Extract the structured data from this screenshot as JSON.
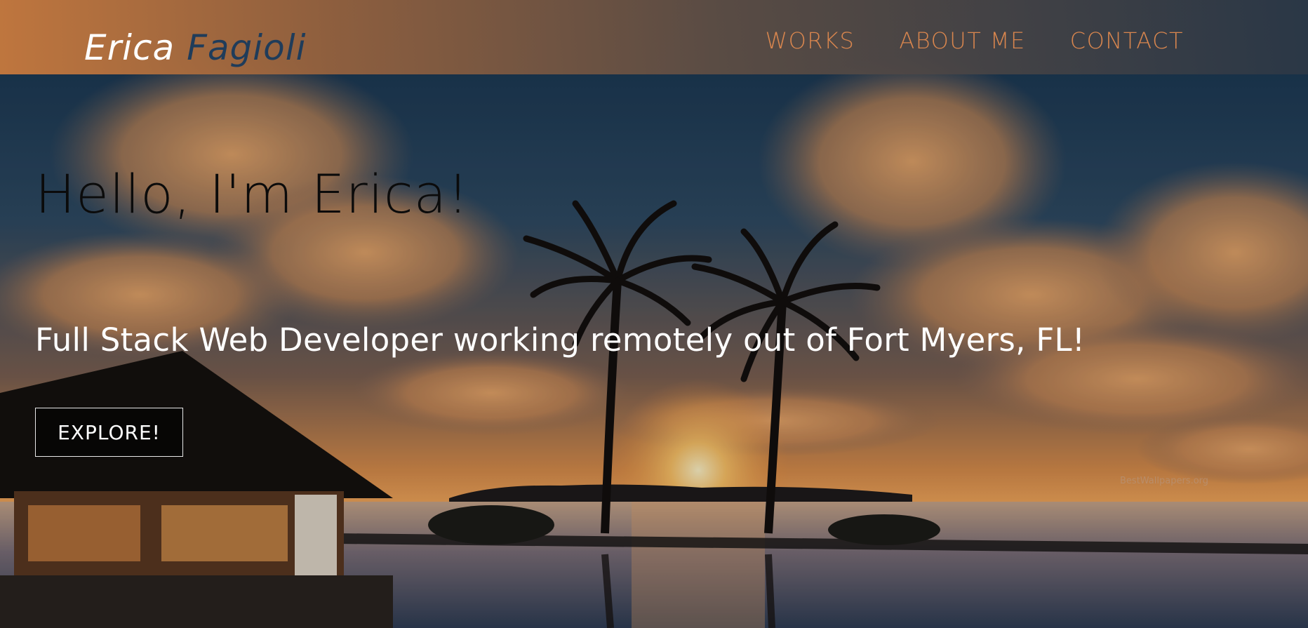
{
  "brand": {
    "first_name": "Erica",
    "last_name": "Fagioli"
  },
  "nav": {
    "items": [
      {
        "label": "WORKS"
      },
      {
        "label": "ABOUT ME"
      },
      {
        "label": "CONTACT"
      }
    ],
    "link_color": "#d9864e"
  },
  "hero": {
    "title": "Hello, I'm Erica!",
    "subtitle": "Full Stack Web Developer working remotely out of Fort Myers, FL!",
    "cta_label": "EXPLORE!",
    "watermark": "BestWallpapers.org"
  },
  "colors": {
    "nav_gradient_start": "#c4783e",
    "nav_gradient_end": "#2c3846",
    "brand_last_name": "#1f3c5a",
    "title_text": "#0b0b0b",
    "subtitle_text": "#ffffff"
  },
  "icons": {
    "background": "sunset-beach-palm-trees-image"
  }
}
